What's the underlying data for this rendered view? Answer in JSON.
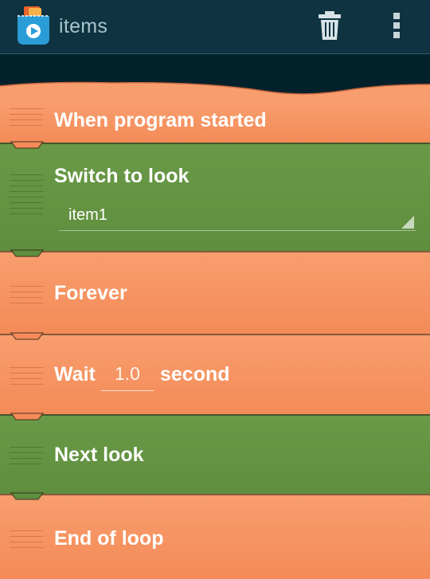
{
  "appbar": {
    "title": "items",
    "icons": {
      "logo": "catrobat-pocketcode-logo",
      "delete": "trash-icon",
      "menu": "overflow-menu-icon"
    }
  },
  "colors": {
    "appbar_bg": "#0f3340",
    "background": "#03212b",
    "brick_orange": "#f7935f",
    "brick_green": "#649440"
  },
  "script": {
    "bricks": [
      {
        "label": "When program started",
        "color": "orange"
      },
      {
        "label": "Switch to look",
        "color": "green",
        "look_value": "item1"
      },
      {
        "label": "Forever",
        "color": "orange"
      },
      {
        "label_before": "Wait",
        "value": "1.0",
        "label_after": "second",
        "color": "orange"
      },
      {
        "label": "Next look",
        "color": "green"
      },
      {
        "label": "End of loop",
        "color": "orange"
      }
    ]
  }
}
